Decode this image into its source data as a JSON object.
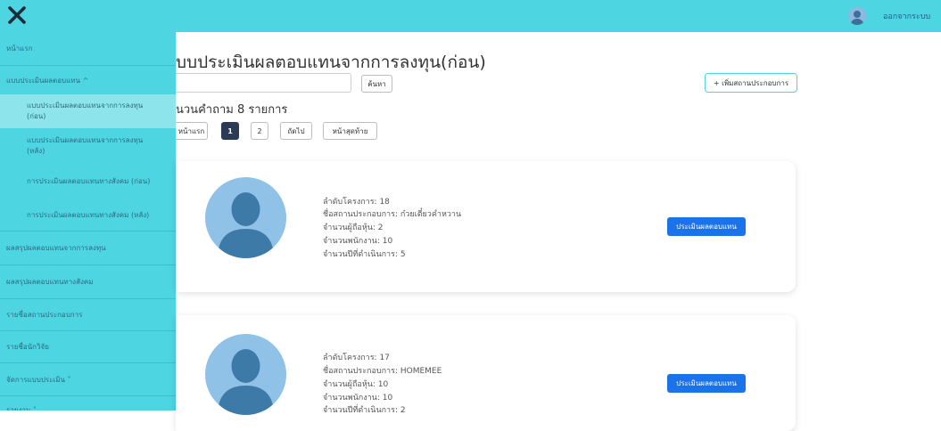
{
  "topbar": {
    "close_icon": "close-icon",
    "avatar_icon": "user-avatar-icon",
    "logout_label": "ออกจากระบบ",
    "accent_color": "#4dd6e2"
  },
  "sidebar": {
    "items": [
      {
        "label": "หน้าแรก"
      },
      {
        "label": "แบบประเมินผลตอบแทน ^"
      },
      {
        "label": "ผลสรุปผลตอบแทนจากการลงทุน"
      },
      {
        "label": "ผลสรุปผลตอบแทนทางสังคม"
      },
      {
        "label": "รายชื่อสถานประกอบการ"
      },
      {
        "label": "รายชื่อนักวิจัย"
      },
      {
        "label": "จัดการแบบประเมิน ˅"
      },
      {
        "label": "รายงาน ˅"
      }
    ],
    "subitems": [
      {
        "label": "แบบประเมินผลตอบแทนจากการลงทุน (ก่อน)",
        "active": true
      },
      {
        "label": "แบบประเมินผลตอบแทนจากการลงทุน (หลัง)"
      },
      {
        "label": "การประเมินผลตอบแทนทางสังคม (ก่อน)"
      },
      {
        "label": "การประเมินผลตอบแทนทางสังคม (หลัง)"
      }
    ]
  },
  "main": {
    "title": "บบประเมินผลตอบแทนจากการลงทุน(ก่อน)",
    "search_placeholder": "",
    "search_button": "ค้นหา",
    "add_button": "+ เพิ่มสถานประกอบการ",
    "count_text": "นวนคำถาม 8 รายการ",
    "pagination": {
      "first": "หน้าแรก",
      "pages": [
        "1",
        "2"
      ],
      "current": "1",
      "next": "ถัดไป",
      "last": "หน้าสุดท้าย"
    }
  },
  "cards": [
    {
      "lines": [
        "ลำดับโครงการ: 18",
        "ชื่อสถานประกอบการ: ก๋วยเตี๋ยวคำหวาน",
        "จำนวนผู้ถือหุ้น: 2",
        "จำนวนพนักงาน: 10",
        "จำนวนปีที่ดำเนินการ: 5"
      ],
      "button": "ประเมินผลตอบแทน"
    },
    {
      "lines": [
        "ลำดับโครงการ: 17",
        "ชื่อสถานประกอบการ: HOMEMEE",
        "จำนวนผู้ถือหุ้น: 10",
        "จำนวนพนักงาน: 10",
        "จำนวนปีที่ดำเนินการ: 2"
      ],
      "button": "ประเมินผลตอบแทน"
    }
  ]
}
